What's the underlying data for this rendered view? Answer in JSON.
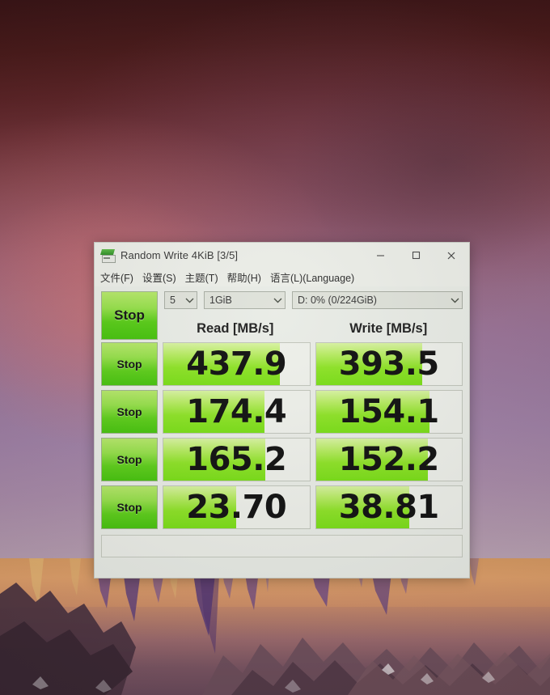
{
  "window": {
    "title": "Random Write 4KiB [3/5]",
    "app_icon": "disk-drive-icon",
    "controls": {
      "minimize": "minimize-icon",
      "maximize": "maximize-icon",
      "close": "close-icon"
    }
  },
  "menubar": {
    "items": [
      {
        "label": "文件(F)"
      },
      {
        "label": "设置(S)"
      },
      {
        "label": "主题(T)"
      },
      {
        "label": "帮助(H)"
      },
      {
        "label": "语言(L)(Language)"
      }
    ]
  },
  "toolbar": {
    "stop_label": "Stop",
    "test_count": "5",
    "test_size": "1GiB",
    "target_drive": "D: 0% (0/224GiB)"
  },
  "columns": {
    "read_header": "Read [MB/s]",
    "write_header": "Write [MB/s]"
  },
  "rows": [
    {
      "button_label": "Stop",
      "read_value": "437.9",
      "read_fill_pct": 80,
      "write_value": "393.5",
      "write_fill_pct": 73
    },
    {
      "button_label": "Stop",
      "read_value": "174.4",
      "read_fill_pct": 69,
      "write_value": "154.1",
      "write_fill_pct": 78
    },
    {
      "button_label": "Stop",
      "read_value": "165.2",
      "read_fill_pct": 70,
      "write_value": "152.2",
      "write_fill_pct": 77
    },
    {
      "button_label": "Stop",
      "read_value": "23.70",
      "read_fill_pct": 50,
      "write_value": "38.81",
      "write_fill_pct": 64
    }
  ],
  "statusbar": {
    "text": ""
  },
  "colors": {
    "accent_green": "#7ade18",
    "button_green": "#5ece1b",
    "window_bg": "#e9ece6",
    "text_dark": "#121212"
  }
}
